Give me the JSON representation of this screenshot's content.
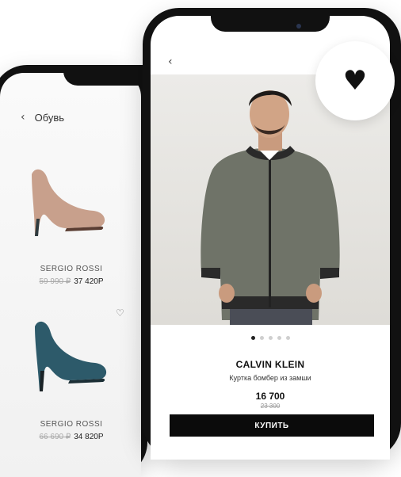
{
  "back_screen": {
    "title": "Обувь",
    "products": [
      {
        "brand": "SERGIO ROSSI",
        "old_price": "59 990 ₽",
        "price": "37 420Р"
      },
      {
        "brand": "SERGIO ROSSI",
        "old_price": "66 690 ₽",
        "price": "34 820Р"
      }
    ]
  },
  "front_screen": {
    "brand": "CALVIN KLEIN",
    "description": "Куртка бомбер из замши",
    "price": "16 700",
    "old_price": "23 300",
    "buy_label": "КУПИТЬ",
    "carousel": {
      "count": 5,
      "active": 0
    }
  },
  "icons": {
    "back": "chevron-left-icon",
    "favorite": "heart-icon"
  },
  "colors": {
    "accent": "#0b0b0b",
    "jacket": "#6f7368",
    "shoe1": "#c8a08c",
    "shoe2": "#2d5a6a"
  }
}
